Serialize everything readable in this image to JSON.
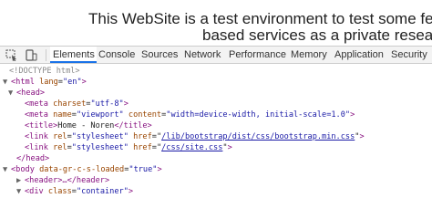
{
  "banner": {
    "line1": "This WebSite is a test environment to test some features a",
    "line2": "based services as a private research pro"
  },
  "devtools": {
    "tabs": [
      {
        "label": "Elements",
        "active": true
      },
      {
        "label": "Console",
        "active": false
      },
      {
        "label": "Sources",
        "active": false
      },
      {
        "label": "Network",
        "active": false
      },
      {
        "label": "Performance",
        "active": false
      },
      {
        "label": "Memory",
        "active": false
      },
      {
        "label": "Application",
        "active": false
      },
      {
        "label": "Security",
        "active": false
      }
    ],
    "icons": {
      "inspect": "inspect-element-icon",
      "device": "device-toolbar-icon"
    }
  },
  "code": {
    "doctype": "<!DOCTYPE html>",
    "html_open_tag": "<html",
    "html_attr": "lang",
    "html_attr_val": "\"en\"",
    "head_tag": "<head>",
    "meta1_tag": "<meta",
    "meta1_attr": "charset",
    "meta1_val": "\"utf-8\"",
    "meta2_tag": "<meta",
    "meta2_attr1": "name",
    "meta2_val1": "\"viewport\"",
    "meta2_attr2": "content",
    "meta2_val2": "\"width=device-width, initial-scale=1.0\"",
    "title_open": "<title>",
    "title_text": "Home - Noren",
    "title_close": "</title>",
    "link1_tag": "<link",
    "link1_attr1": "rel",
    "link1_val1": "\"stylesheet\"",
    "link1_attr2": "href",
    "link1_val2": "/lib/bootstrap/dist/css/bootstrap.min.css",
    "link2_tag": "<link",
    "link2_attr1": "rel",
    "link2_val1": "\"stylesheet\"",
    "link2_attr2": "href",
    "link2_val2": "/css/site.css",
    "head_close": "</head>",
    "body_tag": "<body",
    "body_attr": "data-gr-c-s-loaded",
    "body_val": "\"true\"",
    "header_tag": "<header>…</header>",
    "div_tag": "<div",
    "div_attr": "class",
    "div_val": "\"container\""
  },
  "colors": {
    "tag": "#881280",
    "attr": "#994500",
    "value": "#1a1aa6",
    "comment": "#8a8a8a",
    "active_tab": "#1a73e8"
  }
}
